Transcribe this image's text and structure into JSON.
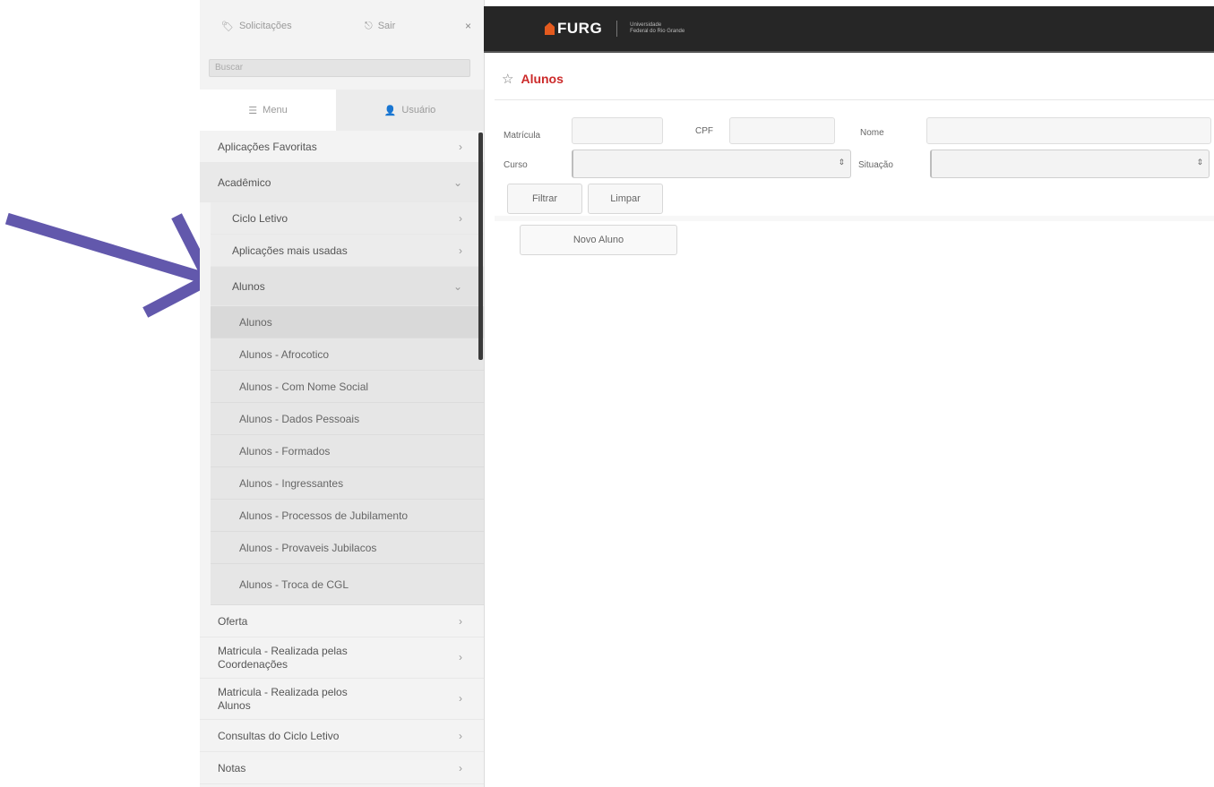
{
  "colors": {
    "arrow": "#6258ac",
    "header_bg": "#262626",
    "title": "#cc2a2a",
    "logo_accent": "#e35a1e",
    "sidebar_bg": "#f3f3f3"
  },
  "sidebar": {
    "top": {
      "requests_icon": "tag-icon",
      "requests_label": "Solicitações",
      "exit_icon": "logout-icon",
      "exit_label": "Sair",
      "close_symbol": "×"
    },
    "search_placeholder": "Buscar",
    "tabs": [
      {
        "icon": "list-icon",
        "label": "Menu"
      },
      {
        "icon": "user-icon",
        "label": "Usuário"
      }
    ],
    "menu": {
      "favoritos": "Aplicações Favoritas",
      "academico": "Acadêmico",
      "academico_children": {
        "ciclo_letivo": "Ciclo Letivo",
        "mais_usadas": "Aplicações mais usadas",
        "alunos_group": "Alunos",
        "alunos_items": [
          "Alunos",
          "Alunos - Afrocotico",
          "Alunos - Com Nome Social",
          "Alunos - Dados Pessoais",
          "Alunos - Formados",
          "Alunos - Ingressantes",
          "Alunos - Processos de Jubilamento",
          "Alunos - Provaveis Jubilacos",
          "Alunos - Troca de CGL"
        ]
      },
      "oferta": "Oferta",
      "matricula_coord": "Matricula - Realizada pelas Coordenações",
      "matricula_alunos": "Matricula - Realizada pelos Alunos",
      "consultas": "Consultas do Ciclo Letivo",
      "notas": "Notas"
    }
  },
  "header": {
    "logo_text": "FURG",
    "subtitle_line1": "Universidade",
    "subtitle_line2": "Federal do Rio Grande"
  },
  "main": {
    "title": "Alunos",
    "filters": {
      "matricula_label": "Matrícula",
      "cpf_label": "CPF",
      "nome_label": "Nome",
      "curso_label": "Curso",
      "situacao_label": "Situação"
    },
    "buttons": {
      "filter": "Filtrar",
      "clear": "Limpar",
      "new_student": "Novo Aluno"
    }
  }
}
